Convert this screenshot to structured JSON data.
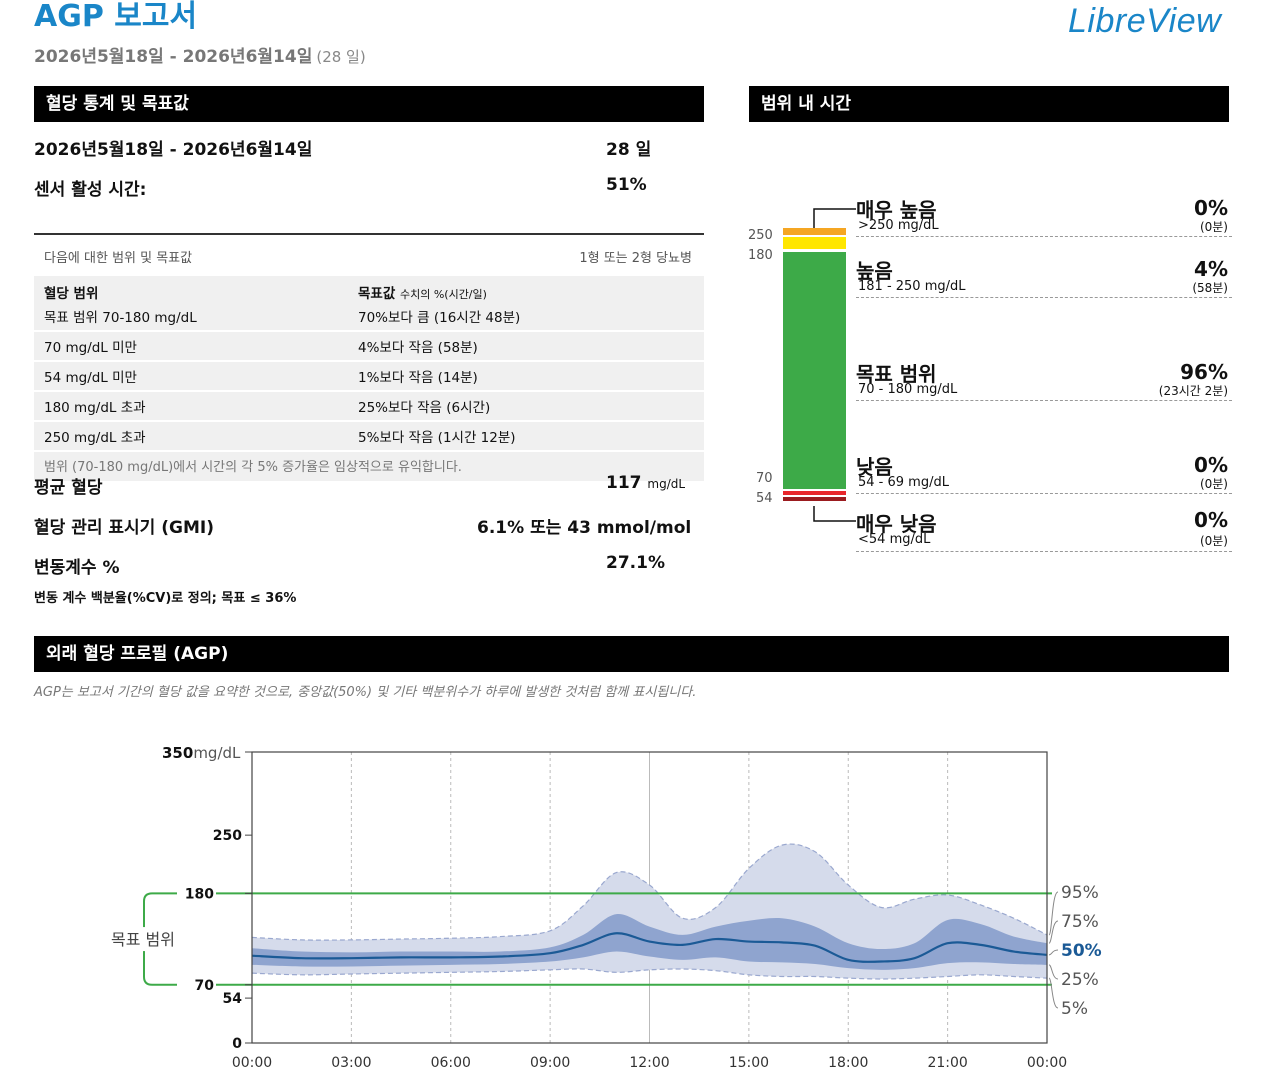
{
  "header": {
    "title": "AGP 보고서",
    "date_range": "2026년5월18일 - 2026년6월14일",
    "days": "(28 일)",
    "logo": "LibreView"
  },
  "stats": {
    "section_title": "혈당 통계 및 목표값",
    "period_label": "2026년5월18일 - 2026년6월14일",
    "period_value": "28 일",
    "sensor_label": "센서 활성 시간:",
    "sensor_value": "51%",
    "table_header_left": "다음에 대한 범위 및 목표값",
    "table_header_right": "1형 또는 2형 당뇨병",
    "col1_header": "혈당 범위",
    "col2_header": "목표값",
    "col2_header_sub": "수치의 %(시간/일)",
    "rows": [
      {
        "range": "목표 범위 70-180 mg/dL",
        "target": "70%보다 큼 (16시간 48분)"
      },
      {
        "range": "70 mg/dL 미만",
        "target": "4%보다 작음 (58분)"
      },
      {
        "range": "54 mg/dL 미만",
        "target": "1%보다 작음 (14분)"
      },
      {
        "range": "180 mg/dL 초과",
        "target": "25%보다 작음 (6시간)"
      },
      {
        "range": "250 mg/dL 초과",
        "target": "5%보다 작음 (1시간 12분)"
      }
    ],
    "table_note": "범위 (70-180 mg/dL)에서 시간의 각 5% 증가율은 임상적으로 유익합니다.",
    "mean_label": "평균 혈당",
    "mean_value": "117",
    "mean_unit": "mg/dL",
    "gmi_label": "혈당 관리 표시기 (GMI)",
    "gmi_value": "6.1% 또는 43 mmol/mol",
    "cv_label": "변동계수 %",
    "cv_value": "27.1%",
    "cv_note": "변동 계수 백분율(%CV)로 정의; 목표 ≤ 36%"
  },
  "tir": {
    "section_title": "범위 내 시간",
    "ticks": [
      "250",
      "180",
      "70",
      "54"
    ],
    "levels": [
      {
        "label": "매우 높음",
        "range": ">250 mg/dL",
        "pct": "0%",
        "dur": "(0분)",
        "color": "#f5a623"
      },
      {
        "label": "높음",
        "range": "181 - 250 mg/dL",
        "pct": "4%",
        "dur": "(58분)",
        "color": "#ffe600"
      },
      {
        "label": "목표 범위",
        "range": "70 - 180 mg/dL",
        "pct": "96%",
        "dur": "(23시간 2분)",
        "color": "#3daa48"
      },
      {
        "label": "낮음",
        "range": "54 - 69 mg/dL",
        "pct": "0%",
        "dur": "(0분)",
        "color": "#e8262b"
      },
      {
        "label": "매우 낮음",
        "range": "<54 mg/dL",
        "pct": "0%",
        "dur": "(0분)",
        "color": "#9b1b1f"
      }
    ]
  },
  "agp": {
    "section_title": "외래 혈당 프로필 (AGP)",
    "note": "AGP는 보고서 기간의 혈당 값을 요약한 것으로, 중앙값(50%) 및 기타 백분위수가 하루에 발생한 것처럼 함께 표시됩니다.",
    "target_label": "목표 범위",
    "y_top_label": "350",
    "y_unit": "mg/dL",
    "y_ticks": [
      "250",
      "180",
      "70",
      "54",
      "0"
    ],
    "percentile_labels": [
      "95%",
      "75%",
      "50%",
      "25%",
      "5%"
    ],
    "colors": {
      "outer_band": "#d5dbeb",
      "inner_band": "#8fa4cf",
      "median": "#1b5a96",
      "target_line": "#3daa48"
    }
  },
  "chart_data": {
    "type": "area",
    "x_labels": [
      "00:00",
      "03:00",
      "06:00",
      "09:00",
      "12:00",
      "15:00",
      "18:00",
      "21:00",
      "00:00"
    ],
    "x": [
      0,
      1.5,
      3,
      4.5,
      6,
      7.5,
      9,
      10,
      11,
      12,
      13,
      14,
      15,
      16,
      17,
      18,
      19,
      20,
      21,
      22,
      23,
      24
    ],
    "ylim": [
      0,
      350
    ],
    "target_range": [
      70,
      180
    ],
    "series": [
      {
        "name": "95%",
        "values": [
          127,
          124,
          124,
          125,
          126,
          128,
          135,
          165,
          205,
          190,
          150,
          163,
          210,
          238,
          230,
          190,
          163,
          173,
          178,
          166,
          150,
          130
        ]
      },
      {
        "name": "75%",
        "values": [
          114,
          110,
          109,
          110,
          110,
          110,
          115,
          130,
          155,
          140,
          130,
          140,
          147,
          150,
          140,
          120,
          113,
          120,
          148,
          143,
          128,
          120
        ]
      },
      {
        "name": "50%",
        "values": [
          105,
          102,
          102,
          103,
          103,
          104,
          108,
          118,
          132,
          122,
          118,
          125,
          122,
          121,
          117,
          100,
          98,
          102,
          120,
          118,
          110,
          106
        ]
      },
      {
        "name": "25%",
        "values": [
          94,
          92,
          92,
          93,
          94,
          95,
          98,
          103,
          110,
          104,
          100,
          103,
          98,
          97,
          95,
          90,
          88,
          90,
          96,
          97,
          95,
          94
        ]
      },
      {
        "name": "5%",
        "values": [
          84,
          82,
          83,
          84,
          85,
          86,
          88,
          89,
          85,
          88,
          89,
          87,
          82,
          80,
          80,
          78,
          77,
          78,
          80,
          82,
          80,
          78
        ]
      }
    ]
  }
}
